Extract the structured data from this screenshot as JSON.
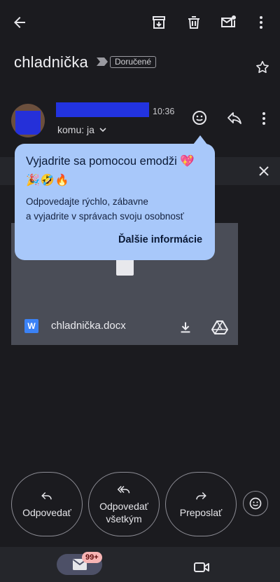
{
  "subject": "chladnička",
  "label": "Doručené",
  "message": {
    "time": "10:36",
    "recipient": "komu: ja"
  },
  "tooltip": {
    "title": "Vyjadrite sa pomocou emodži 💖",
    "emojis": "🎉🤣🔥",
    "body_line1": "Odpovedajte rýchlo, zábavne",
    "body_line2": "a vyjadrite v správach svoju osobnosť",
    "link": "Ďalšie informácie"
  },
  "attachment": {
    "type_letter": "W",
    "filename": "chladnička.docx"
  },
  "actions": {
    "reply": "Odpovedať",
    "reply_all_line1": "Odpovedať",
    "reply_all_line2": "všetkým",
    "forward": "Preposlať"
  },
  "nav": {
    "mail_badge": "99+"
  },
  "colors": {
    "background": "#1b1b1f",
    "tooltip": "#a8c8fa",
    "attachment_card": "#4a4d57",
    "badge": "#f7b4b4"
  }
}
